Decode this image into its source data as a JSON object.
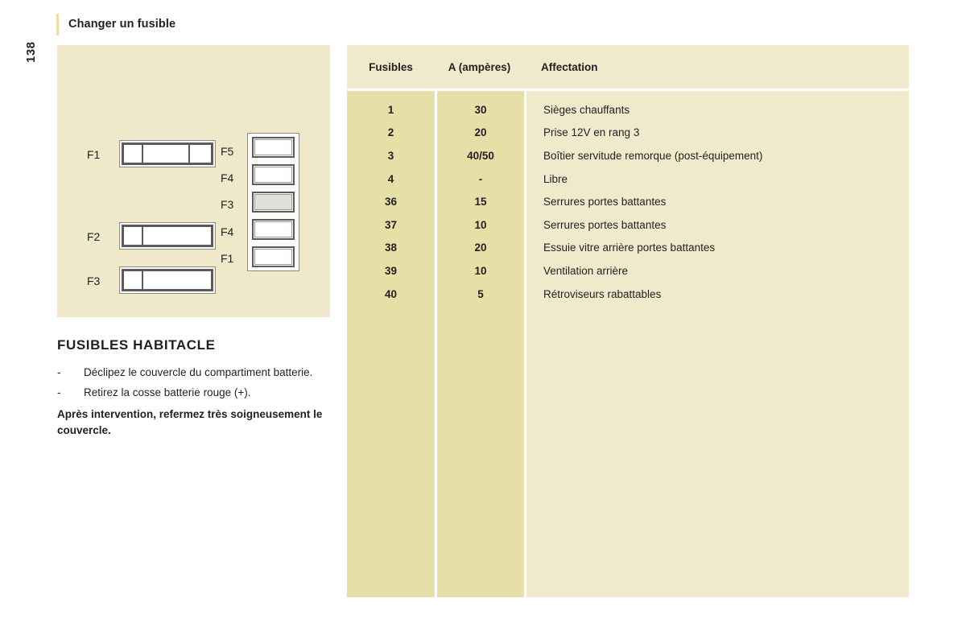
{
  "page": {
    "number": "138"
  },
  "header": {
    "title": "Changer un fusible",
    "accent_color": "#e8dfa8"
  },
  "diagram": {
    "name": "fuse-box-diagram",
    "background_color": "#efe8ca",
    "horizontal_fuses": [
      {
        "label": "F1"
      },
      {
        "label": "F2"
      },
      {
        "label": "F3"
      }
    ],
    "vertical_fuses": [
      {
        "label": "F5"
      },
      {
        "label": "F4"
      },
      {
        "label": "F3"
      },
      {
        "label": "F4"
      },
      {
        "label": "F1"
      }
    ]
  },
  "left_section": {
    "title": "FUSIBLES HABITACLE",
    "dash": "-",
    "bullets": [
      "Déclipez le couvercle du compartiment batterie.",
      "Retirez la cosse batterie rouge (+)."
    ],
    "note": "Après intervention, refermez très soigneusement le couvercle."
  },
  "table": {
    "headers": {
      "fusibles": "Fusibles",
      "amperes": "A (ampères)",
      "affectation": "Affectation"
    },
    "header_bg": "#f0e9cc",
    "col_bg_dark": "#e7dfa8",
    "col_bg_light": "#f0e9cc",
    "rows": [
      {
        "fusible": "1",
        "amperes": "30",
        "affectation": "Sièges chauffants"
      },
      {
        "fusible": "2",
        "amperes": "20",
        "affectation": "Prise 12V en rang 3"
      },
      {
        "fusible": "3",
        "amperes": "40/50",
        "affectation": "Boîtier servitude remorque (post-équipement)"
      },
      {
        "fusible": "4",
        "amperes": "-",
        "affectation": "Libre"
      },
      {
        "fusible": "36",
        "amperes": "15",
        "affectation": "Serrures portes battantes"
      },
      {
        "fusible": "37",
        "amperes": "10",
        "affectation": "Serrures portes battantes"
      },
      {
        "fusible": "38",
        "amperes": "20",
        "affectation": "Essuie vitre arrière portes battantes"
      },
      {
        "fusible": "39",
        "amperes": "10",
        "affectation": "Ventilation arrière"
      },
      {
        "fusible": "40",
        "amperes": "5",
        "affectation": "Rétroviseurs rabattables"
      }
    ]
  }
}
